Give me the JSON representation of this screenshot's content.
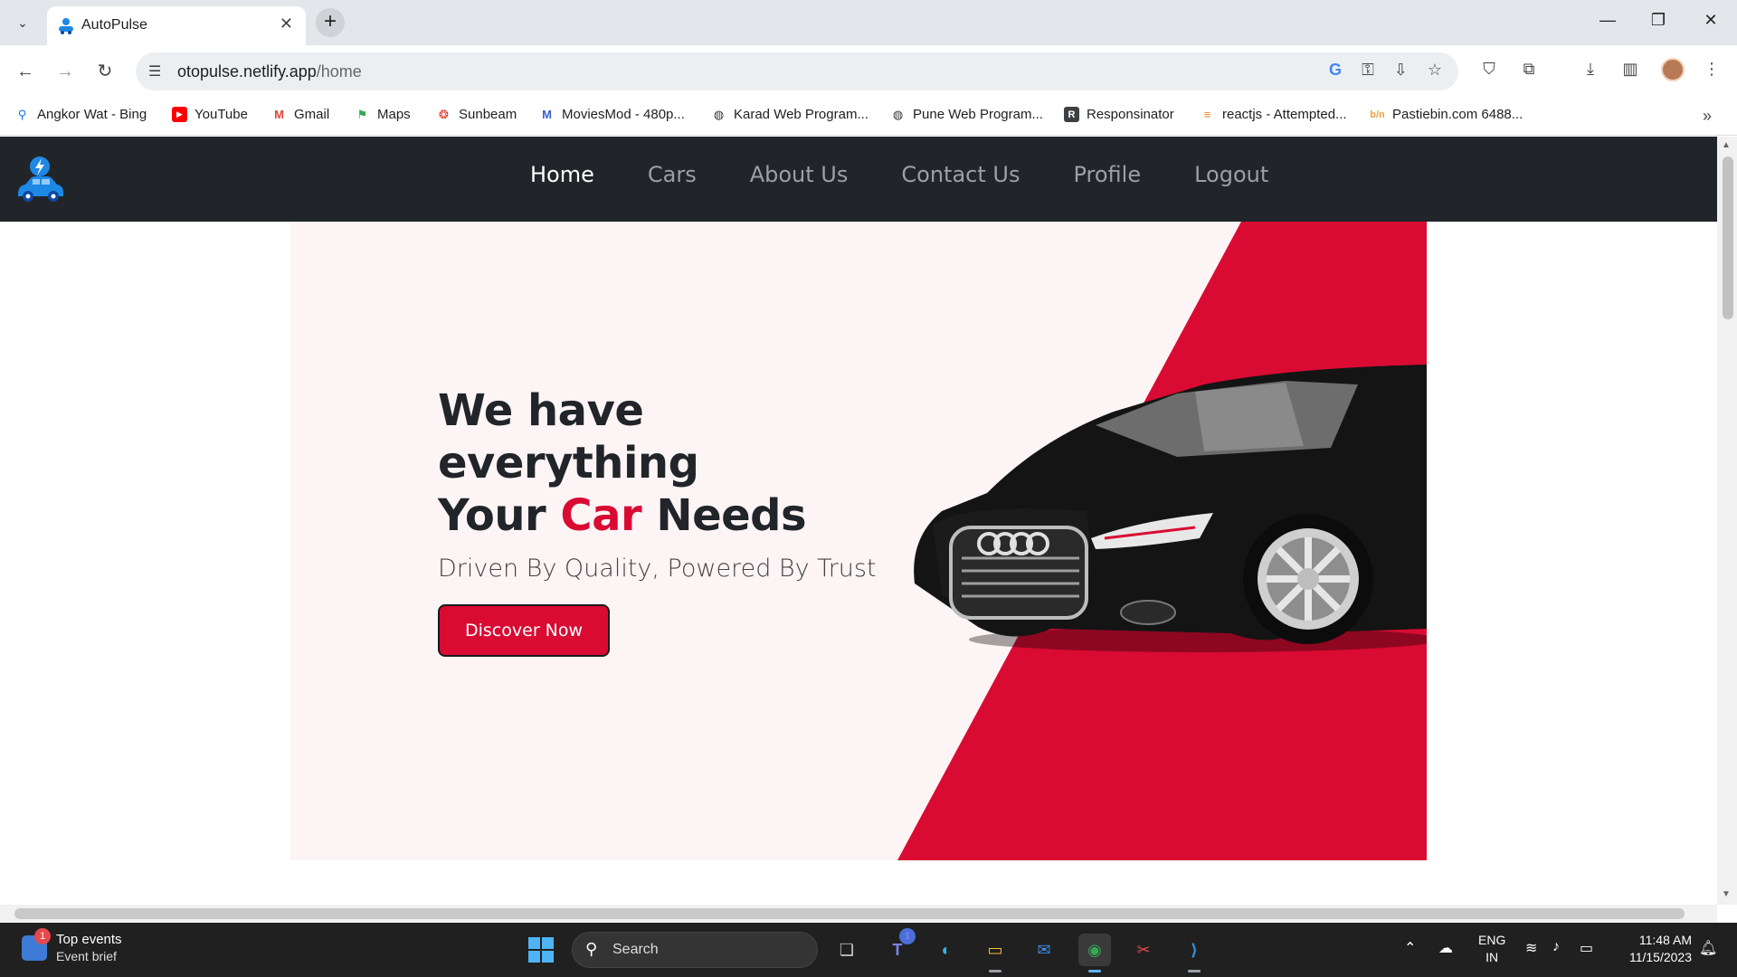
{
  "browser": {
    "tab_title": "AutoPulse",
    "url_host": "otopulse.netlify.app",
    "url_path": "/home",
    "bookmarks": [
      {
        "label": "Angkor Wat - Bing",
        "icon": "search-icon",
        "color": "#1a73e8"
      },
      {
        "label": "YouTube",
        "icon": "youtube-icon",
        "color": "#ff0000"
      },
      {
        "label": "Gmail",
        "icon": "gmail-icon",
        "color": "#ea4335"
      },
      {
        "label": "Maps",
        "icon": "maps-icon",
        "color": "#34a853"
      },
      {
        "label": "Sunbeam",
        "icon": "sunbeam-icon",
        "color": "#d93025"
      },
      {
        "label": "MoviesMod - 480p...",
        "icon": "moviesmod-icon",
        "color": "#3c5bd6"
      },
      {
        "label": "Karad Web Program...",
        "icon": "globe-icon",
        "color": "#333333"
      },
      {
        "label": "Pune Web Program...",
        "icon": "globe-icon",
        "color": "#333333"
      },
      {
        "label": "Responsinator",
        "icon": "responsinator-icon",
        "color": "#3c4043"
      },
      {
        "label": "reactjs - Attempted...",
        "icon": "stackoverflow-icon",
        "color": "#f48024"
      },
      {
        "label": "Pastiebin.com 6488...",
        "icon": "pastiebin-icon",
        "color": "#e8a33d"
      }
    ]
  },
  "site": {
    "nav": [
      "Home",
      "Cars",
      "About Us",
      "Contact Us",
      "Profile",
      "Logout"
    ],
    "hero": {
      "title_line1": "We have everything",
      "title_line2_pre": "Your ",
      "title_line2_accent": "Car",
      "title_line2_post": " Needs",
      "subtitle": "Driven By Quality, Powered By Trust",
      "cta": "Discover Now"
    },
    "accent_color": "#d90b33"
  },
  "taskbar": {
    "widget_title": "Top events",
    "widget_sub": "Event brief",
    "widget_badge": "1",
    "search_label": "Search",
    "teams_badge": "1",
    "lang_line1": "ENG",
    "lang_line2": "IN",
    "time": "11:48 AM",
    "date": "11/15/2023"
  }
}
